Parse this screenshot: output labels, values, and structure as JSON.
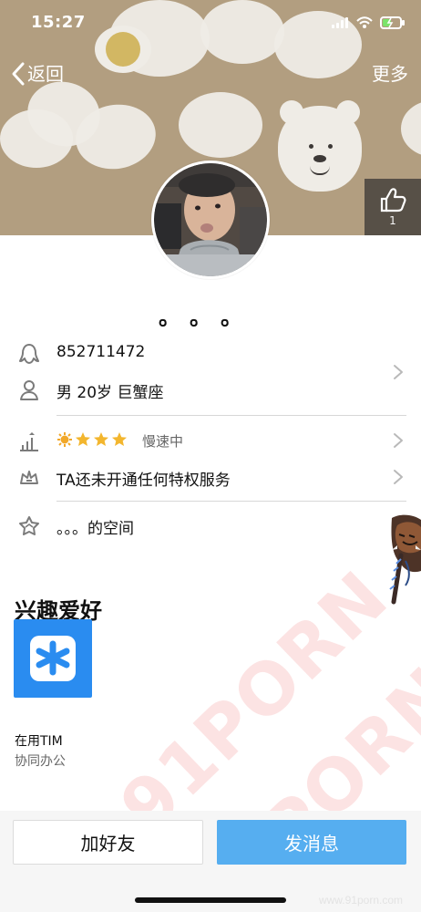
{
  "status_bar": {
    "time": "15:27"
  },
  "nav": {
    "back_label": "返回",
    "more_label": "更多"
  },
  "profile": {
    "name": "。。。",
    "like_count": "1",
    "qq_number": "852711472",
    "basic_info": "男 20岁 巨蟹座",
    "level_status": "慢速中",
    "privilege": "TA还未开通任何特权服务",
    "space": "。。。的空间"
  },
  "interests": {
    "title": "兴趣爱好",
    "app_name": "在用TIM",
    "app_category": "协同办公"
  },
  "actions": {
    "add_friend": "加好友",
    "send_message": "发消息"
  },
  "watermark": {
    "text": "91PORN"
  },
  "corner_mark": "www.91porn.com",
  "icons": {
    "qq": "qq-icon",
    "user": "user-icon",
    "level": "level-icon",
    "privilege": "crown-icon",
    "space": "star-bubble-icon",
    "like": "thumbs-up-icon",
    "back": "chevron-left-icon",
    "chevron": "chevron-right-icon"
  },
  "colors": {
    "cover": "#b29e80",
    "primary_button": "#56aef0",
    "app_tile": "#2a8cf0",
    "watermark": "#f06c6c"
  }
}
